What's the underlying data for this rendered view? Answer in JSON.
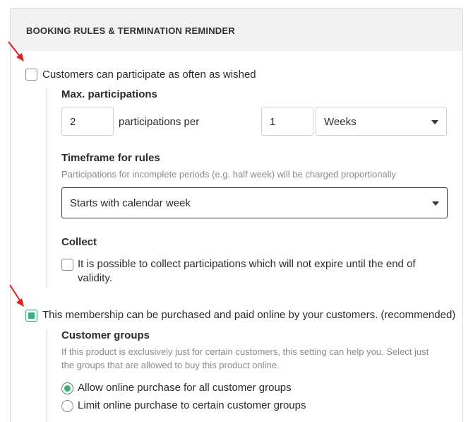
{
  "panel": {
    "title": "BOOKING RULES & TERMINATION REMINDER"
  },
  "participate_often": {
    "label": "Customers can participate as often as wished",
    "checked": false
  },
  "max_participations": {
    "heading": "Max. participations",
    "count_value": "2",
    "per_label": "participations per",
    "period_value": "1",
    "unit_selected": "Weeks"
  },
  "timeframe": {
    "heading": "Timeframe for rules",
    "hint": "Participations for incomplete periods (e.g. half week) will be charged proportionally",
    "selected": "Starts with calendar week"
  },
  "collect": {
    "heading": "Collect",
    "label_line1": "It is possible to collect participations which will not expire until the end of",
    "label_line2": "validity.",
    "checked": false
  },
  "online_purchase": {
    "label": "This membership can be purchased and paid online by your customers. (recommended)",
    "checked": true
  },
  "customer_groups": {
    "heading": "Customer groups",
    "hint_line1": "If this product is exclusively just for certain customers, this setting can help you. Select just",
    "hint_line2": "the groups that are allowed to buy this product online.",
    "options": [
      {
        "label": "Allow online purchase for all customer groups",
        "selected": true
      },
      {
        "label": "Limit online purchase to certain customer groups",
        "selected": false
      }
    ]
  },
  "colors": {
    "accent": "#3fae7e",
    "annotation_arrow": "#e02020"
  }
}
